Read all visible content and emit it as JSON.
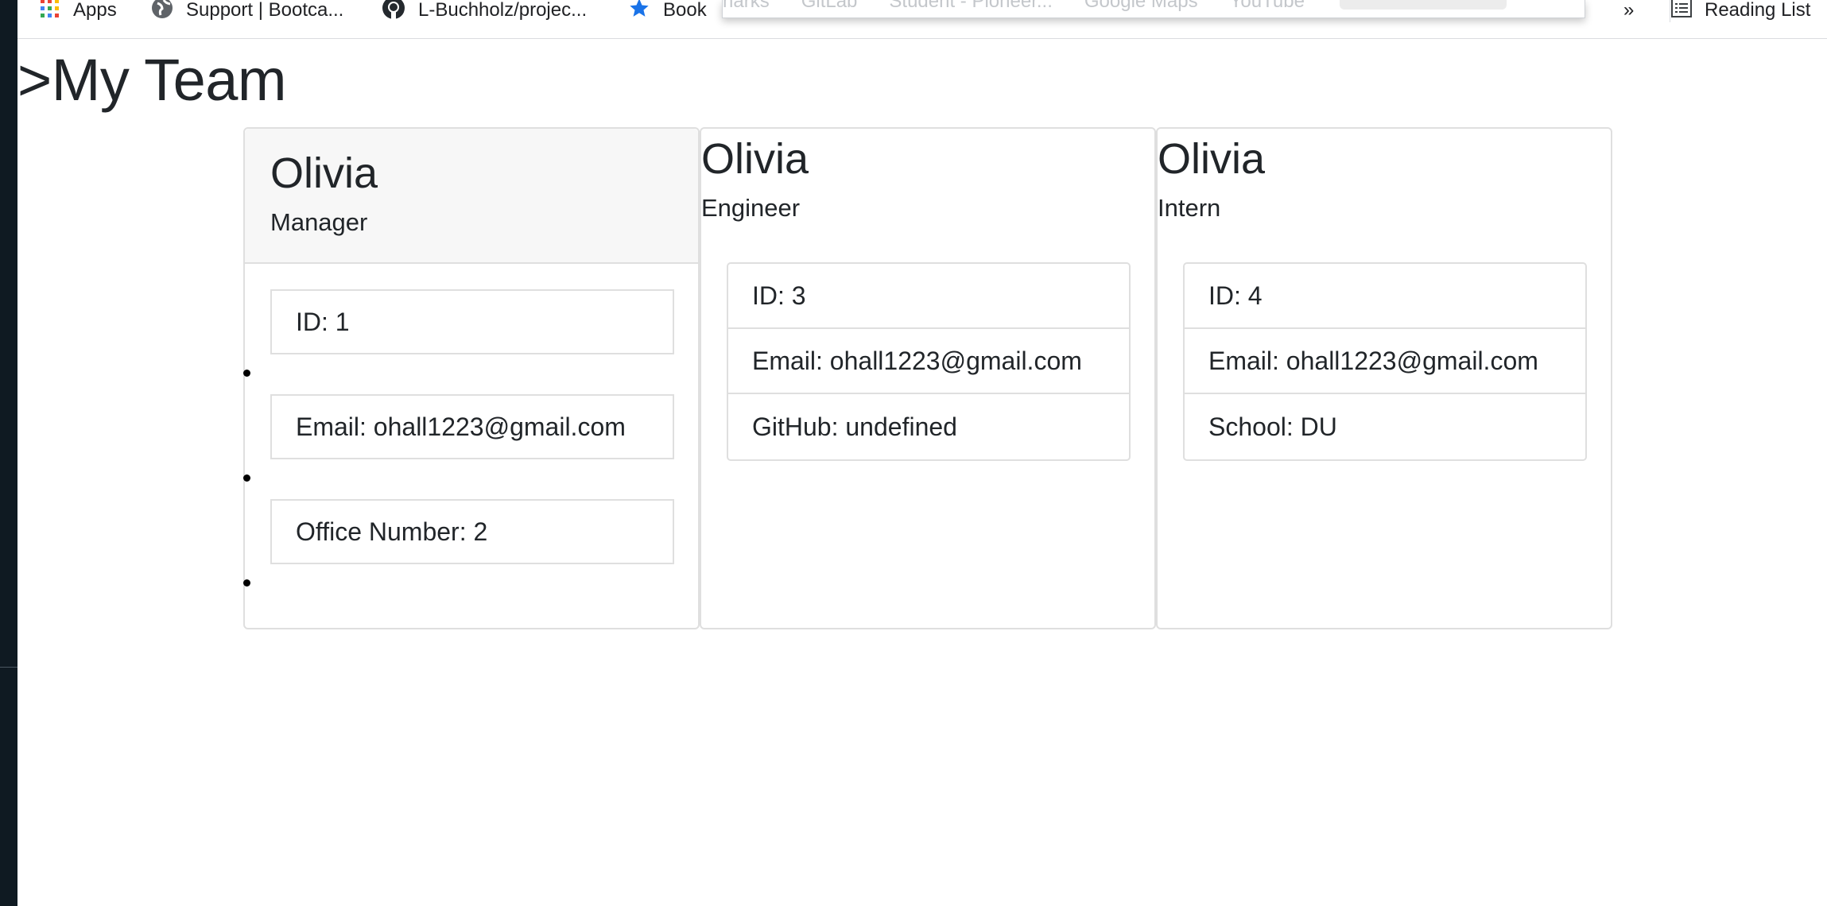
{
  "bookmarks": {
    "items": [
      {
        "label": "Apps",
        "icon": "apps-grid-icon"
      },
      {
        "label": "Support | Bootca...",
        "icon": "globe-icon"
      },
      {
        "label": "L-Buchholz/projec...",
        "icon": "github-icon"
      },
      {
        "label": "Book",
        "icon": "star-icon"
      }
    ],
    "overflow_label": "»",
    "reading_list_label": "Reading List",
    "faded_items": [
      "narks",
      "GitLab",
      "Student - Pioneer...",
      "Google Maps",
      "YouTube"
    ]
  },
  "page": {
    "title": ">My Team"
  },
  "team": [
    {
      "name": "Olivia",
      "role": "Manager",
      "details": [
        "ID: 1",
        "Email: ohall1223@gmail.com",
        "Office Number: 2"
      ]
    },
    {
      "name": "Olivia",
      "role": "Engineer",
      "details": [
        "ID: 3",
        "Email: ohall1223@gmail.com",
        "GitHub: undefined"
      ]
    },
    {
      "name": "Olivia",
      "role": "Intern",
      "details": [
        "ID: 4",
        "Email: ohall1223@gmail.com",
        "School: DU"
      ]
    }
  ],
  "colors": {
    "apps_icon": [
      "#ea4335",
      "#fbbc04",
      "#34a853",
      "#4285f4"
    ],
    "star_icon": "#1a73e8",
    "card_border": "#dfdfdf",
    "header_bg": "#f7f7f7"
  }
}
